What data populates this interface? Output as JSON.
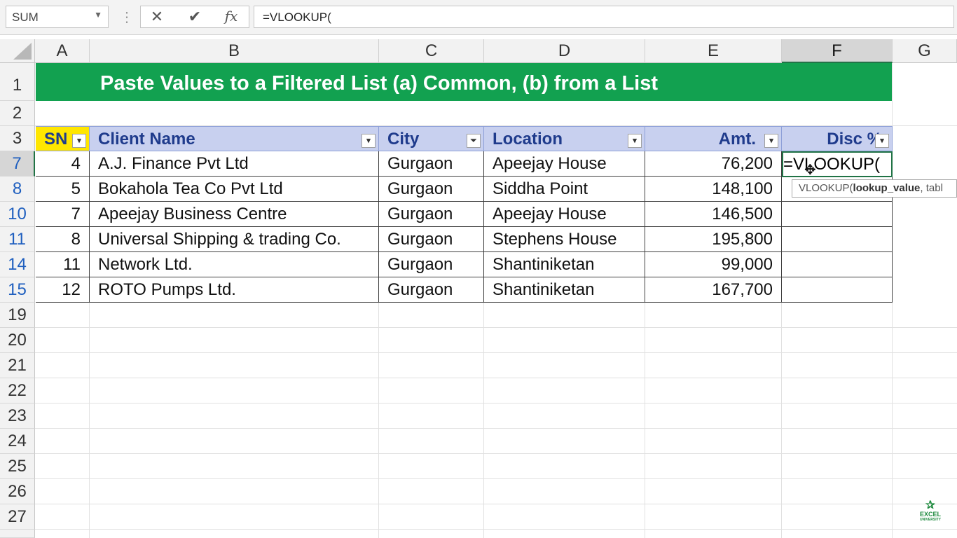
{
  "formula_bar": {
    "name_box": "SUM",
    "cancel_icon": "✕",
    "enter_icon": "✔",
    "fx_icon": "fx",
    "formula": "=VLOOKUP("
  },
  "columns": [
    "A",
    "B",
    "C",
    "D",
    "E",
    "F",
    "G"
  ],
  "rows": [
    "1",
    "2",
    "3",
    "7",
    "8",
    "10",
    "11",
    "14",
    "15",
    "19",
    "20",
    "21",
    "22",
    "23",
    "24",
    "25",
    "26",
    "27"
  ],
  "title": "Paste Values to a Filtered List (a) Common, (b) from a List",
  "table": {
    "headers": [
      "SN",
      "Client Name",
      "City",
      "Location",
      "Amt.",
      "Disc %"
    ],
    "header_truncated": {
      "amt": "Amt. |",
      "disc": "Disc %"
    },
    "rows": [
      [
        "4",
        "A.J. Finance Pvt Ltd",
        "Gurgaon",
        "Apeejay House",
        "76,200"
      ],
      [
        "5",
        "Bokahola Tea Co Pvt Ltd",
        "Gurgaon",
        "Siddha Point",
        "148,100"
      ],
      [
        "7",
        "Apeejay Business Centre",
        "Gurgaon",
        "Apeejay House",
        "146,500"
      ],
      [
        "8",
        "Universal Shipping & trading Co.",
        "Gurgaon",
        "Stephens House",
        "195,800"
      ],
      [
        "11",
        "Network Ltd.",
        "Gurgaon",
        "Shantiniketan",
        "99,000"
      ],
      [
        "12",
        "ROTO Pumps Ltd.",
        "Gurgaon",
        "Shantiniketan",
        "167,700"
      ]
    ]
  },
  "active_cell": {
    "ref": "F7",
    "content": "=VLOOKUP("
  },
  "tooltip": {
    "func": "VLOOKUP(",
    "arg": "lookup_value",
    "rest": ", tabl"
  },
  "logo": {
    "line1": "EXCEL",
    "line2": "UNIVERSITY"
  },
  "colors": {
    "title_bg": "#12a150",
    "header_bg": "#c8d0ef",
    "sn_bg": "#ffe600",
    "accent": "#217346"
  }
}
